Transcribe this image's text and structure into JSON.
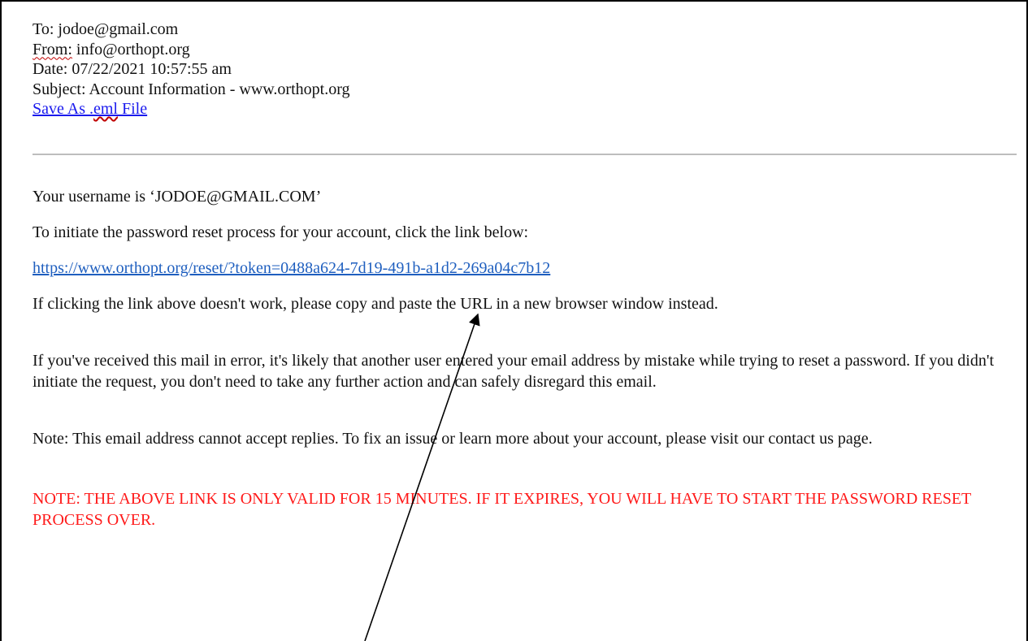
{
  "header": {
    "to_label": "To:",
    "to_value": "jodoe@gmail.com",
    "from_label": "From:",
    "from_value": "info@orthopt.org",
    "date_label": "Date:",
    "date_value": "07/22/2021 10:57:55 am",
    "subject_label": "Subject:",
    "subject_value": "Account Information - www.orthopt.org",
    "save_link_prefix": "Save As .",
    "save_link_ext": "eml",
    "save_link_suffix": " File"
  },
  "body": {
    "username_line": "Your username is ‘JODOE@GMAIL.COM’",
    "instruction_line": "To initiate the password reset process for your account, click the link below:",
    "reset_url": "https://www.orthopt.org/reset/?token=0488a624-7d19-491b-a1d2-269a04c7b12",
    "fallback_line": "If clicking the link above doesn't work, please copy and paste the URL in a new browser window instead.",
    "error_line": "If you've received this mail in error, it's likely that another user entered your email address by mistake while trying to reset a password. If you didn't initiate the request, you don't need to take any further action and can safely disregard this email.",
    "note_line": "Note: This email address cannot accept replies. To fix an issue or learn more about your account, please visit our contact us page.",
    "warning_line": "NOTE: THE ABOVE LINK IS ONLY VALID FOR 15 MINUTES. IF IT EXPIRES, YOU WILL HAVE TO START THE PASSWORD RESET PROCESS OVER."
  },
  "colors": {
    "link": "#1f5fbf",
    "warning": "#ff1a1a",
    "divider": "#bdbdbd",
    "annotation_arrow": "#000000"
  },
  "annotation": {
    "icon": "arrow-pointer-icon"
  }
}
